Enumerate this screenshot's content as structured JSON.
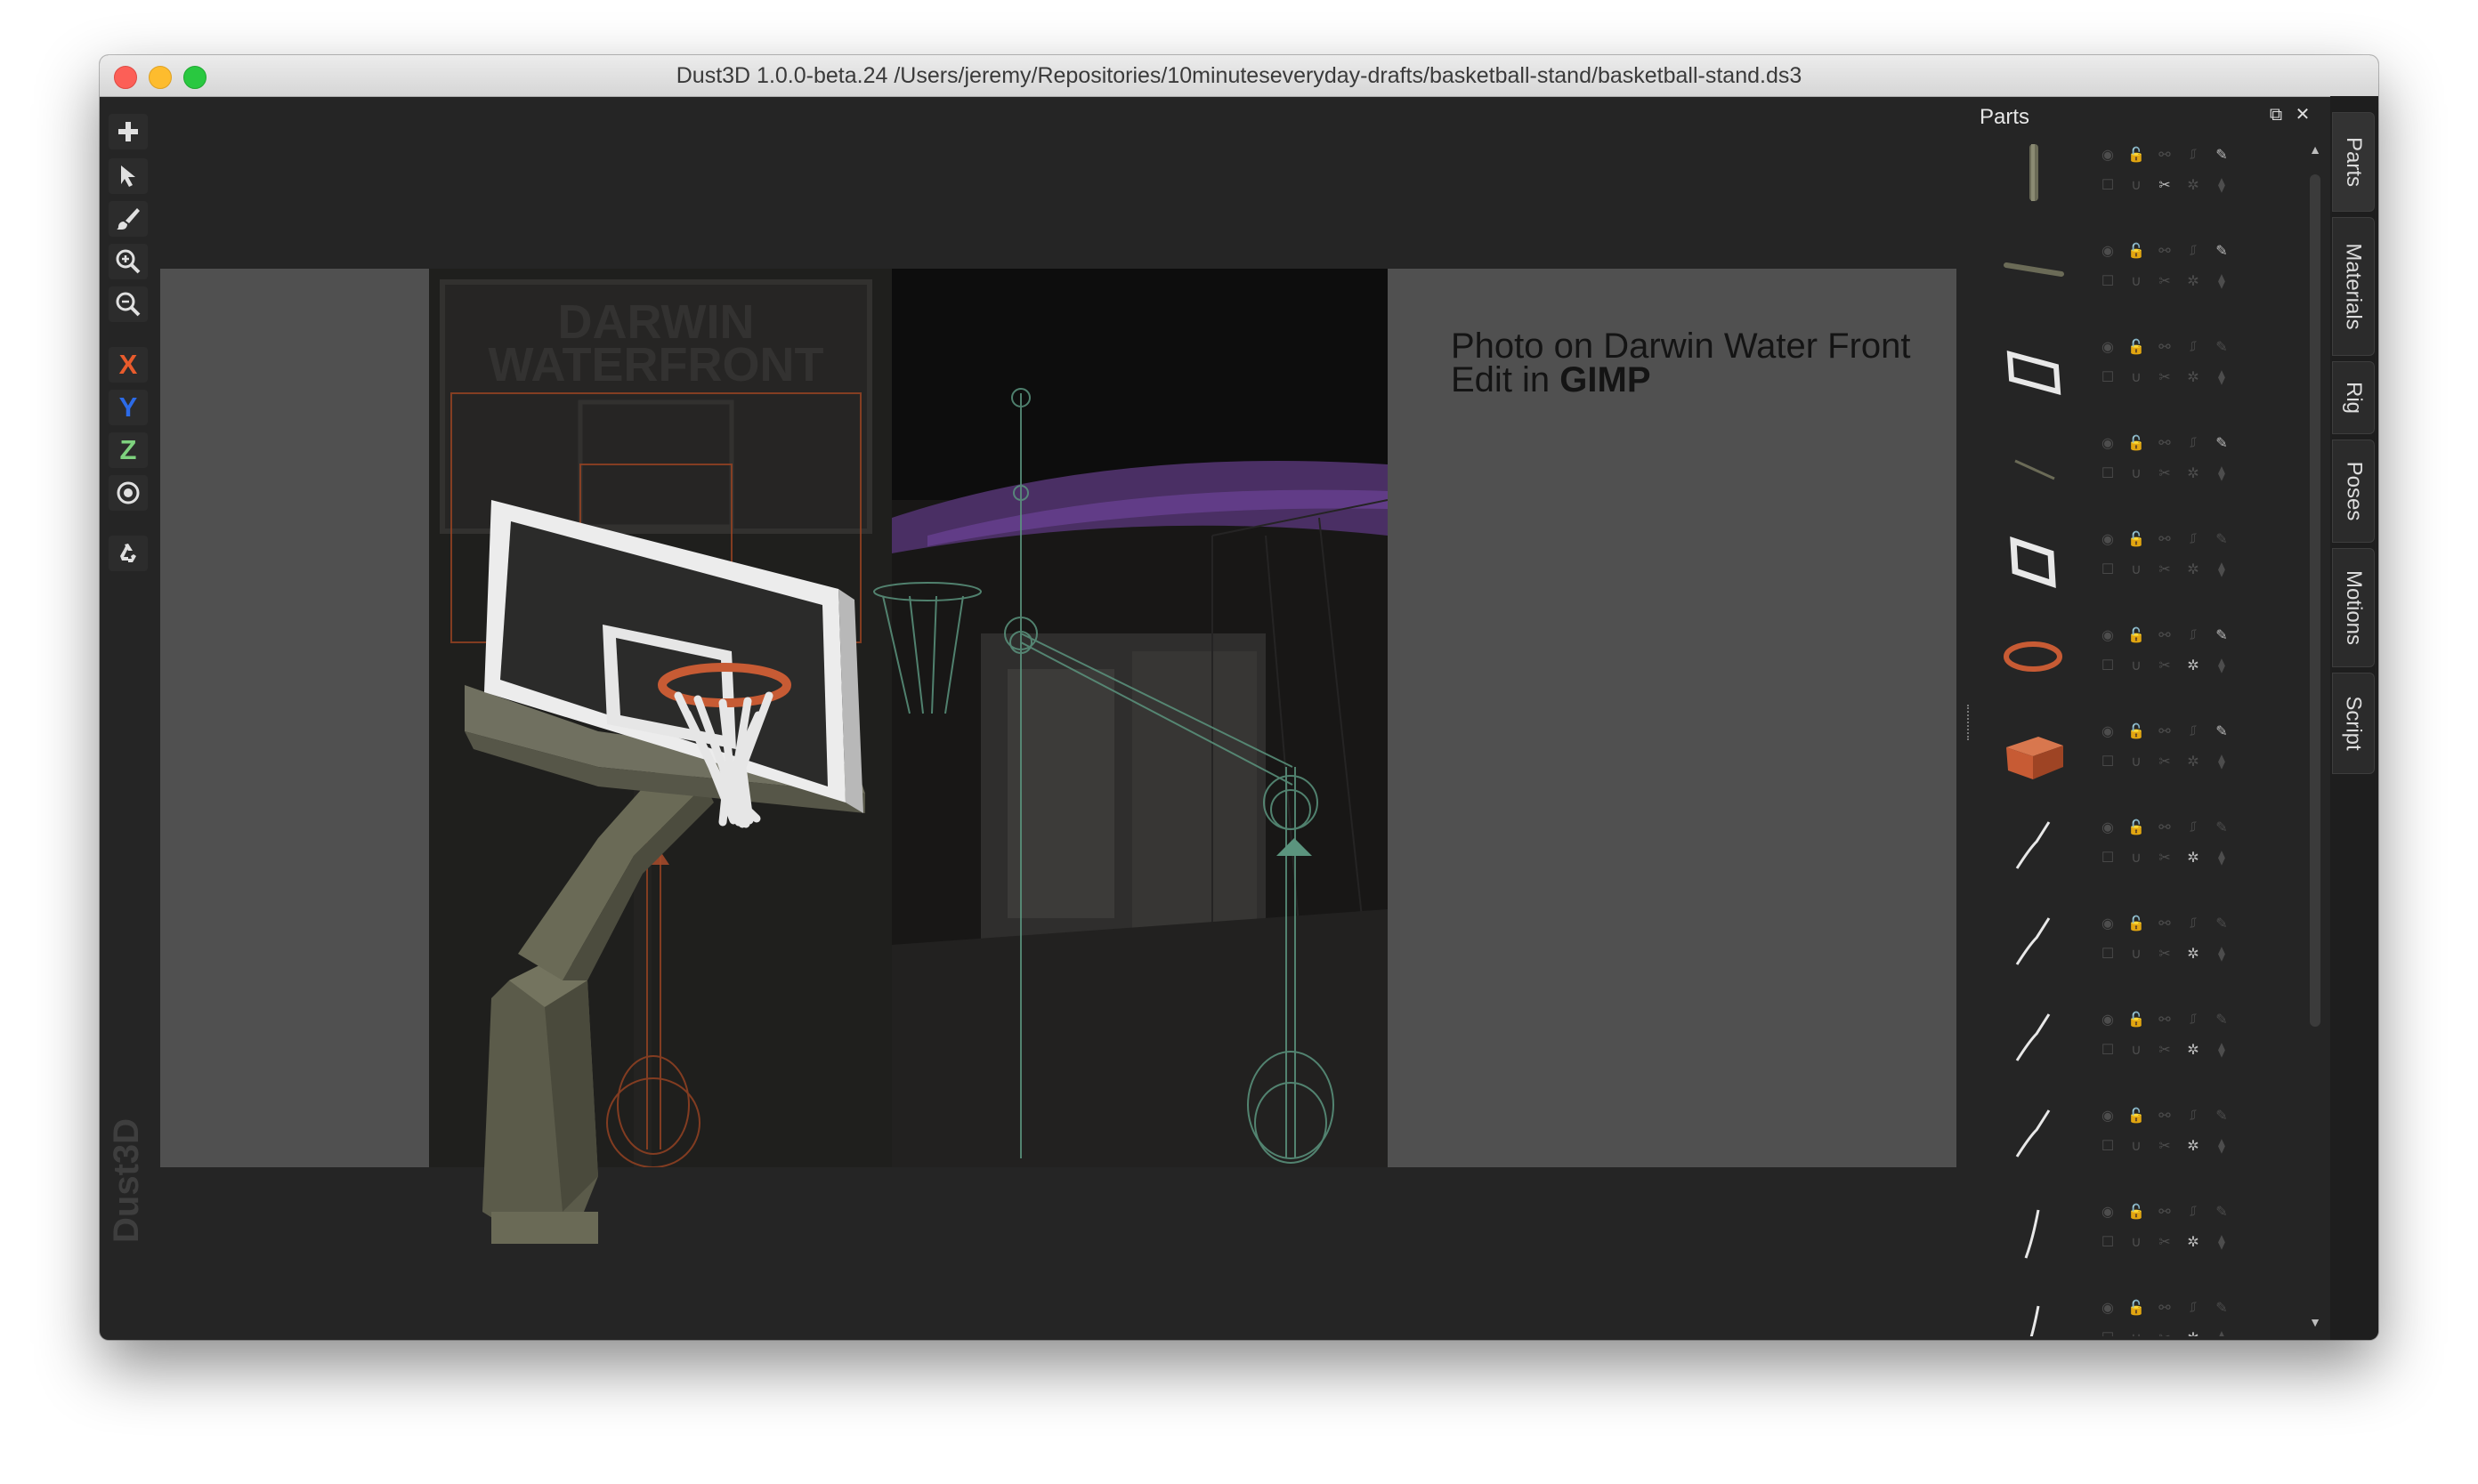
{
  "window": {
    "title": "Dust3D 1.0.0-beta.24 /Users/jeremy/Repositories/10minuteseveryday-drafts/basketball-stand/basketball-stand.ds3"
  },
  "toolbar": {
    "tools": [
      {
        "name": "add-icon"
      },
      {
        "name": "select-pointer-icon"
      },
      {
        "name": "paint-brush-icon"
      },
      {
        "name": "zoom-in-icon"
      },
      {
        "name": "zoom-out-icon"
      }
    ],
    "axes": [
      {
        "label": "X",
        "color": "#e85b2c"
      },
      {
        "label": "Y",
        "color": "#2c6be8"
      },
      {
        "label": "Z",
        "color": "#7ed27e"
      }
    ],
    "radio_icon": "radio-target-icon",
    "regenerate_icon": "recycle-icon"
  },
  "canvas": {
    "photo_text": [
      "DARWIN",
      "WATERFRONT"
    ],
    "caption_line1": "Photo on Darwin Water Front",
    "caption_line2_prefix": "Edit in ",
    "caption_line2_bold": "GIMP",
    "watermark": "Dust3D"
  },
  "parts_panel": {
    "title": "Parts",
    "float_icon": "float-window-icon",
    "close_icon": "close-icon",
    "items": [
      {
        "thumb": "pole-vertical",
        "color": "#6b6b57",
        "lock": false,
        "cut": true,
        "rot": false,
        "color_on": true
      },
      {
        "thumb": "stick-diagonal",
        "color": "#6b6b57",
        "lock": false,
        "cut": false,
        "rot": false,
        "color_on": true
      },
      {
        "thumb": "frame-large",
        "color": "#e8e8e8",
        "lock": false,
        "cut": false,
        "rot": false,
        "color_on": false
      },
      {
        "thumb": "stick-thin",
        "color": "#6b6b57",
        "lock": false,
        "cut": false,
        "rot": false,
        "color_on": true
      },
      {
        "thumb": "frame-small",
        "color": "#e8e8e8",
        "lock": false,
        "cut": false,
        "rot": false,
        "color_on": false
      },
      {
        "thumb": "ring",
        "color": "#c75b34",
        "lock": false,
        "cut": false,
        "rot": true,
        "color_on": true
      },
      {
        "thumb": "box",
        "color": "#c75b34",
        "lock": false,
        "cut": false,
        "rot": false,
        "color_on": true
      },
      {
        "thumb": "net-strand",
        "color": "#e8e8e8",
        "lock": false,
        "cut": false,
        "rot": true,
        "color_on": false
      },
      {
        "thumb": "net-strand",
        "color": "#e8e8e8",
        "lock": false,
        "cut": false,
        "rot": true,
        "color_on": false
      },
      {
        "thumb": "net-strand",
        "color": "#e8e8e8",
        "lock": false,
        "cut": false,
        "rot": true,
        "color_on": false
      },
      {
        "thumb": "net-strand",
        "color": "#e8e8e8",
        "lock": false,
        "cut": false,
        "rot": true,
        "color_on": false
      },
      {
        "thumb": "net-strand-straight",
        "color": "#e8e8e8",
        "lock": false,
        "cut": false,
        "rot": true,
        "color_on": false
      },
      {
        "thumb": "net-strand-straight",
        "color": "#e8e8e8",
        "lock": false,
        "cut": false,
        "rot": true,
        "color_on": false
      }
    ]
  },
  "side_tabs": [
    "Parts",
    "Materials",
    "Rig",
    "Poses",
    "Motions",
    "Script"
  ]
}
